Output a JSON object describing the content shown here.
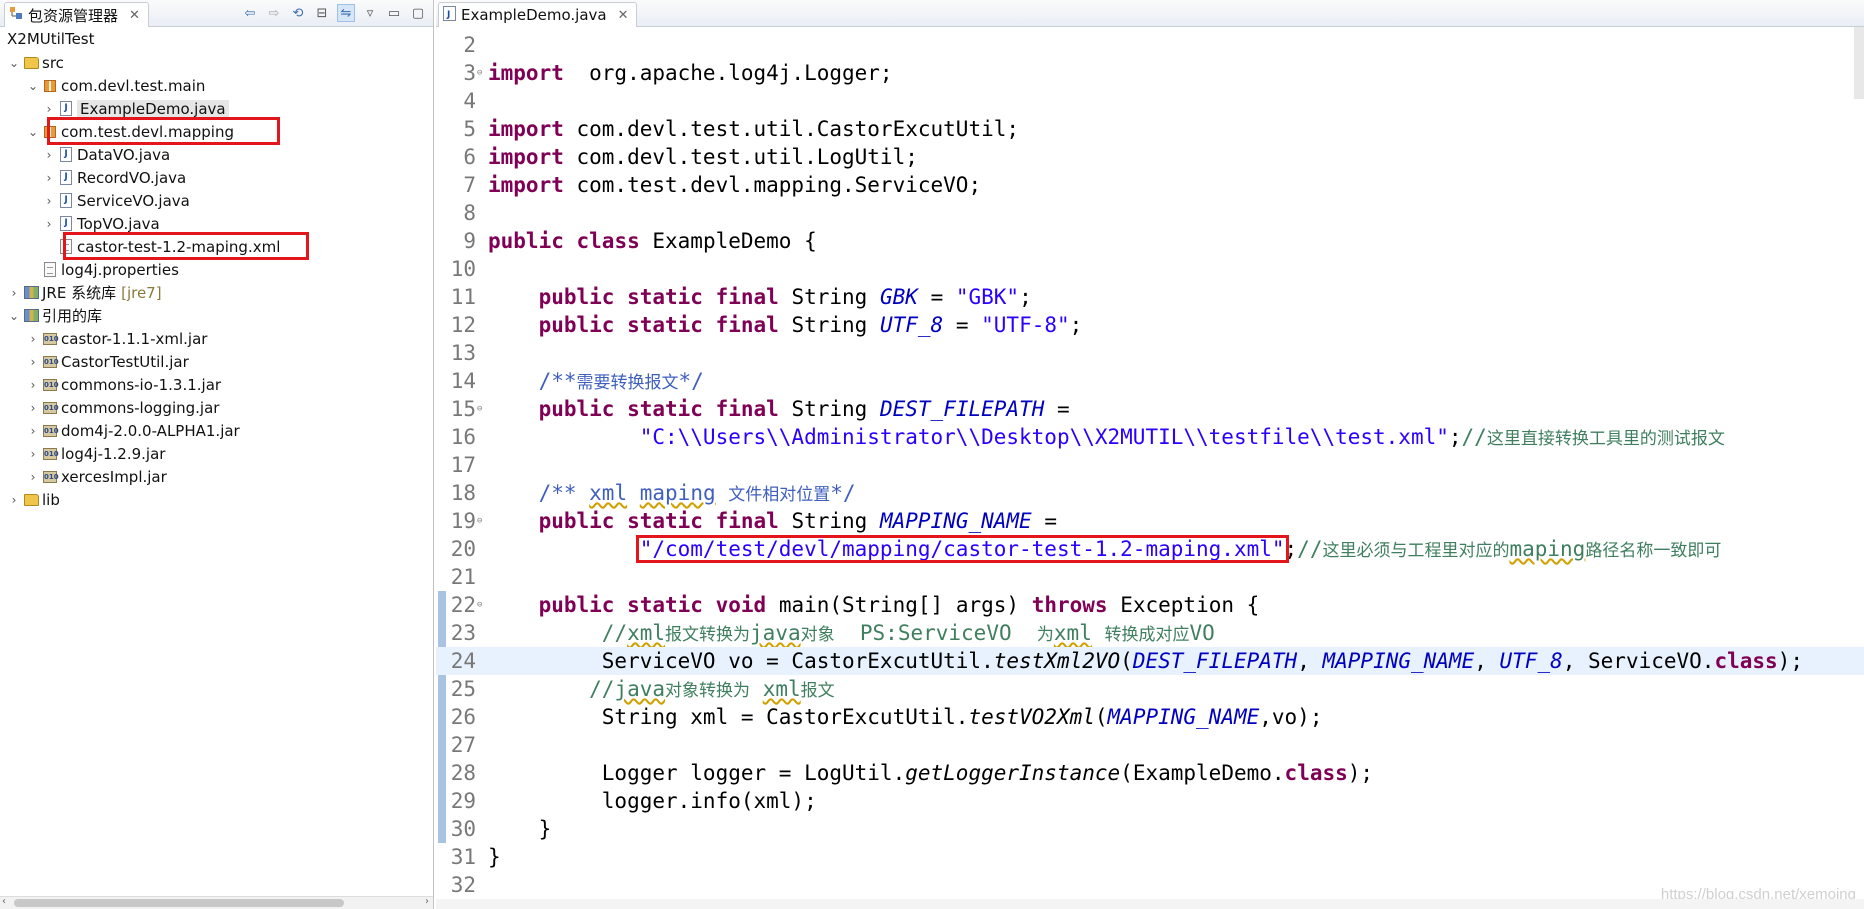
{
  "left": {
    "tab_title": "包资源管理器",
    "tab_close": "✕",
    "project_name": "X2MUtilTest",
    "toolbar": [
      "back-icon",
      "forward-icon",
      "link-icon",
      "collapse-all-icon",
      "link-editor-icon",
      "view-menu-icon",
      "minimize-icon",
      "maximize-icon"
    ],
    "tree": [
      {
        "label": "src",
        "icon": "source-folder-icon",
        "depth": 0,
        "arrow": "⌄"
      },
      {
        "label": "com.devl.test.main",
        "icon": "package-icon",
        "depth": 1,
        "arrow": "⌄"
      },
      {
        "label": "ExampleDemo.java",
        "icon": "java-file-icon",
        "depth": 2,
        "arrow": "›",
        "selected": true
      },
      {
        "label": "com.test.devl.mapping",
        "icon": "package-icon",
        "depth": 1,
        "arrow": "⌄",
        "highlight": true
      },
      {
        "label": "DataVO.java",
        "icon": "java-file-icon",
        "depth": 2,
        "arrow": "›"
      },
      {
        "label": "RecordVO.java",
        "icon": "java-file-icon",
        "depth": 2,
        "arrow": "›"
      },
      {
        "label": "ServiceVO.java",
        "icon": "java-file-icon",
        "depth": 2,
        "arrow": "›"
      },
      {
        "label": "TopVO.java",
        "icon": "java-file-icon",
        "depth": 2,
        "arrow": "›"
      },
      {
        "label": "castor-test-1.2-maping.xml",
        "icon": "xml-file-icon",
        "depth": 2,
        "arrow": "",
        "highlight": true
      },
      {
        "label": "log4j.properties",
        "icon": "properties-file-icon",
        "depth": 1,
        "arrow": ""
      },
      {
        "label": "JRE 系统库",
        "decor": "[jre7]",
        "icon": "library-icon",
        "depth": 0,
        "arrow": "›"
      },
      {
        "label": "引用的库",
        "icon": "library-icon",
        "depth": 0,
        "arrow": "⌄"
      },
      {
        "label": "castor-1.1.1-xml.jar",
        "icon": "jar-icon",
        "depth": 1,
        "arrow": "›"
      },
      {
        "label": "CastorTestUtil.jar",
        "icon": "jar-icon",
        "depth": 1,
        "arrow": "›"
      },
      {
        "label": "commons-io-1.3.1.jar",
        "icon": "jar-icon",
        "depth": 1,
        "arrow": "›"
      },
      {
        "label": "commons-logging.jar",
        "icon": "jar-icon",
        "depth": 1,
        "arrow": "›"
      },
      {
        "label": "dom4j-2.0.0-ALPHA1.jar",
        "icon": "jar-icon",
        "depth": 1,
        "arrow": "›"
      },
      {
        "label": "log4j-1.2.9.jar",
        "icon": "jar-icon",
        "depth": 1,
        "arrow": "›"
      },
      {
        "label": "xercesImpl.jar",
        "icon": "jar-icon",
        "depth": 1,
        "arrow": "›"
      },
      {
        "label": "lib",
        "icon": "folder-icon",
        "depth": 0,
        "arrow": "›"
      }
    ]
  },
  "editor": {
    "tab_title": "ExampleDemo.java",
    "tab_close": "✕",
    "current_line": 24,
    "watermark": "https://blog.csdn.net/xemoing",
    "lines": [
      {
        "n": "2",
        "t": []
      },
      {
        "n": "3",
        "fold": true,
        "t": [
          [
            "kw",
            "import"
          ],
          [
            "",
            "  org.apache.log4j.Logger;"
          ]
        ]
      },
      {
        "n": "4",
        "t": []
      },
      {
        "n": "5",
        "t": [
          [
            "kw",
            "import"
          ],
          [
            "",
            " com.devl.test.util.CastorExcutUtil;"
          ]
        ]
      },
      {
        "n": "6",
        "t": [
          [
            "kw",
            "import"
          ],
          [
            "",
            " com.devl.test.util.LogUtil;"
          ]
        ]
      },
      {
        "n": "7",
        "t": [
          [
            "kw",
            "import"
          ],
          [
            "",
            " com.test.devl.mapping.ServiceVO;"
          ]
        ]
      },
      {
        "n": "8",
        "t": []
      },
      {
        "n": "9",
        "t": [
          [
            "kw",
            "public"
          ],
          [
            "",
            " "
          ],
          [
            "kw",
            "class"
          ],
          [
            "",
            " ExampleDemo {"
          ]
        ]
      },
      {
        "n": "10",
        "t": []
      },
      {
        "n": "11",
        "t": [
          [
            "",
            "    "
          ],
          [
            "kw",
            "public"
          ],
          [
            "",
            " "
          ],
          [
            "kw",
            "static"
          ],
          [
            "",
            " "
          ],
          [
            "kw",
            "final"
          ],
          [
            "",
            " String "
          ],
          [
            "cn",
            "GBK"
          ],
          [
            "",
            " = "
          ],
          [
            "str",
            "\"GBK\""
          ],
          [
            "",
            ";"
          ]
        ]
      },
      {
        "n": "12",
        "t": [
          [
            "",
            "    "
          ],
          [
            "kw",
            "public"
          ],
          [
            "",
            " "
          ],
          [
            "kw",
            "static"
          ],
          [
            "",
            " "
          ],
          [
            "kw",
            "final"
          ],
          [
            "",
            " String "
          ],
          [
            "cn",
            "UTF_8"
          ],
          [
            "",
            " = "
          ],
          [
            "str",
            "\"UTF-8\""
          ],
          [
            "",
            ";"
          ]
        ]
      },
      {
        "n": "13",
        "t": []
      },
      {
        "n": "14",
        "t": [
          [
            "",
            "    "
          ],
          [
            "jd",
            "/**"
          ],
          [
            "jd cjk",
            "需要转换报文"
          ],
          [
            "jd",
            "*/"
          ]
        ]
      },
      {
        "n": "15",
        "fold": true,
        "t": [
          [
            "",
            "    "
          ],
          [
            "kw",
            "public"
          ],
          [
            "",
            " "
          ],
          [
            "kw",
            "static"
          ],
          [
            "",
            " "
          ],
          [
            "kw",
            "final"
          ],
          [
            "",
            " String "
          ],
          [
            "cn",
            "DEST_FILEPATH"
          ],
          [
            "",
            " ="
          ]
        ]
      },
      {
        "n": "16",
        "t": [
          [
            "",
            "            "
          ],
          [
            "str",
            "\"C:\\\\Users\\\\Administrator\\\\Desktop\\\\X2MUTIL\\\\testfile\\\\test.xml\""
          ],
          [
            "",
            ";"
          ],
          [
            "cm",
            "//"
          ],
          [
            "cm cjk",
            "这里直接转换工具里的测试报文"
          ]
        ]
      },
      {
        "n": "17",
        "t": []
      },
      {
        "n": "18",
        "t": [
          [
            "",
            "    "
          ],
          [
            "jd",
            "/** "
          ],
          [
            "jd sq",
            "xml"
          ],
          [
            "jd",
            " "
          ],
          [
            "jd sq",
            "maping"
          ],
          [
            "jd",
            " "
          ],
          [
            "jd cjk",
            "文件相对位置"
          ],
          [
            "jd",
            "*/"
          ]
        ]
      },
      {
        "n": "19",
        "fold": true,
        "t": [
          [
            "",
            "    "
          ],
          [
            "kw",
            "public"
          ],
          [
            "",
            " "
          ],
          [
            "kw",
            "static"
          ],
          [
            "",
            " "
          ],
          [
            "kw",
            "final"
          ],
          [
            "",
            " String "
          ],
          [
            "cn",
            "MAPPING_NAME"
          ],
          [
            "",
            " ="
          ]
        ]
      },
      {
        "n": "20",
        "t": [
          [
            "",
            "            "
          ],
          [
            "str",
            "\"/com/test/devl/mapping/castor-test-1.2-maping.xml\""
          ],
          [
            "",
            ";"
          ],
          [
            "cm",
            "//"
          ],
          [
            "cm cjk",
            "这里必须与工程里对应的"
          ],
          [
            "cm sq",
            "maping"
          ],
          [
            "cm cjk",
            "路径名称一致即可"
          ]
        ]
      },
      {
        "n": "21",
        "t": []
      },
      {
        "n": "22",
        "fold": true,
        "t": [
          [
            "",
            "    "
          ],
          [
            "kw",
            "public"
          ],
          [
            "",
            " "
          ],
          [
            "kw",
            "static"
          ],
          [
            "",
            " "
          ],
          [
            "kw",
            "void"
          ],
          [
            "",
            " main(String[] args) "
          ],
          [
            "kw",
            "throws"
          ],
          [
            "",
            " Exception {"
          ]
        ]
      },
      {
        "n": "23",
        "t": [
          [
            "",
            "         "
          ],
          [
            "cm",
            "//"
          ],
          [
            "cm sq",
            "xml"
          ],
          [
            "cm cjk",
            "报文转换为"
          ],
          [
            "cm sq",
            "java"
          ],
          [
            "cm cjk",
            "对象"
          ],
          [
            "cm",
            "  PS:ServiceVO  "
          ],
          [
            "cm cjk",
            "为"
          ],
          [
            "cm sq",
            "xml"
          ],
          [
            "cm",
            " "
          ],
          [
            "cm cjk",
            "转换成对应"
          ],
          [
            "cm",
            "VO"
          ]
        ]
      },
      {
        "n": "24",
        "t": [
          [
            "",
            "         ServiceVO vo = CastorExcutUtil."
          ],
          [
            "sm",
            "testXml2VO"
          ],
          [
            "",
            "("
          ],
          [
            "cn",
            "DEST_FILEPATH"
          ],
          [
            "",
            ", "
          ],
          [
            "cn",
            "MAPPING_NAME"
          ],
          [
            "",
            ", "
          ],
          [
            "cn",
            "UTF_8"
          ],
          [
            "",
            ", ServiceVO."
          ],
          [
            "kw",
            "class"
          ],
          [
            "",
            ");"
          ]
        ]
      },
      {
        "n": "25",
        "t": [
          [
            "",
            "        "
          ],
          [
            "cm",
            "//"
          ],
          [
            "cm sq",
            "java"
          ],
          [
            "cm cjk",
            "对象转换为"
          ],
          [
            "cm",
            " "
          ],
          [
            "cm sq",
            "xml"
          ],
          [
            "cm cjk",
            "报文"
          ]
        ]
      },
      {
        "n": "26",
        "t": [
          [
            "",
            "         String xml = CastorExcutUtil."
          ],
          [
            "sm",
            "testVO2Xml"
          ],
          [
            "",
            "("
          ],
          [
            "cn",
            "MAPPING_NAME"
          ],
          [
            "",
            ",vo);"
          ]
        ]
      },
      {
        "n": "27",
        "t": []
      },
      {
        "n": "28",
        "t": [
          [
            "",
            "         Logger logger = LogUtil."
          ],
          [
            "sm",
            "getLoggerInstance"
          ],
          [
            "",
            "(ExampleDemo."
          ],
          [
            "kw",
            "class"
          ],
          [
            "",
            ");"
          ]
        ]
      },
      {
        "n": "29",
        "t": [
          [
            "",
            "         logger.info(xml);"
          ]
        ]
      },
      {
        "n": "30",
        "t": [
          [
            "",
            "    }"
          ]
        ]
      },
      {
        "n": "31",
        "t": [
          [
            "",
            "}"
          ]
        ]
      },
      {
        "n": "32",
        "t": []
      }
    ]
  }
}
